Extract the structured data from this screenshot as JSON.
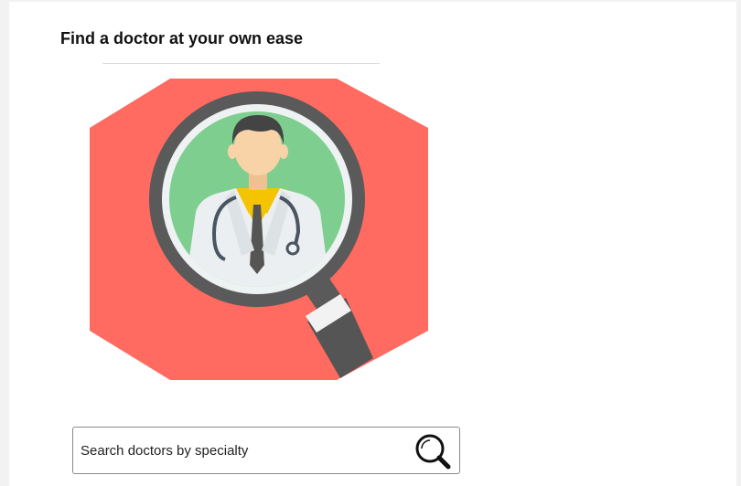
{
  "header": {
    "title": "Find a doctor at your own ease"
  },
  "illustration": {
    "icon": "doctor-magnifier-illustration",
    "colors": {
      "background_octagon": "#ff6b61",
      "lens_fill": "#7ecf8f",
      "lens_ring": "#5a5a5a",
      "handle": "#5a5a5a",
      "coat": "#eceff1",
      "shirt": "#f5c400",
      "skin": "#f9d3a8",
      "hair": "#444444"
    }
  },
  "search": {
    "placeholder": "Search doctors by specialty",
    "value": "",
    "button_icon": "search-icon"
  }
}
